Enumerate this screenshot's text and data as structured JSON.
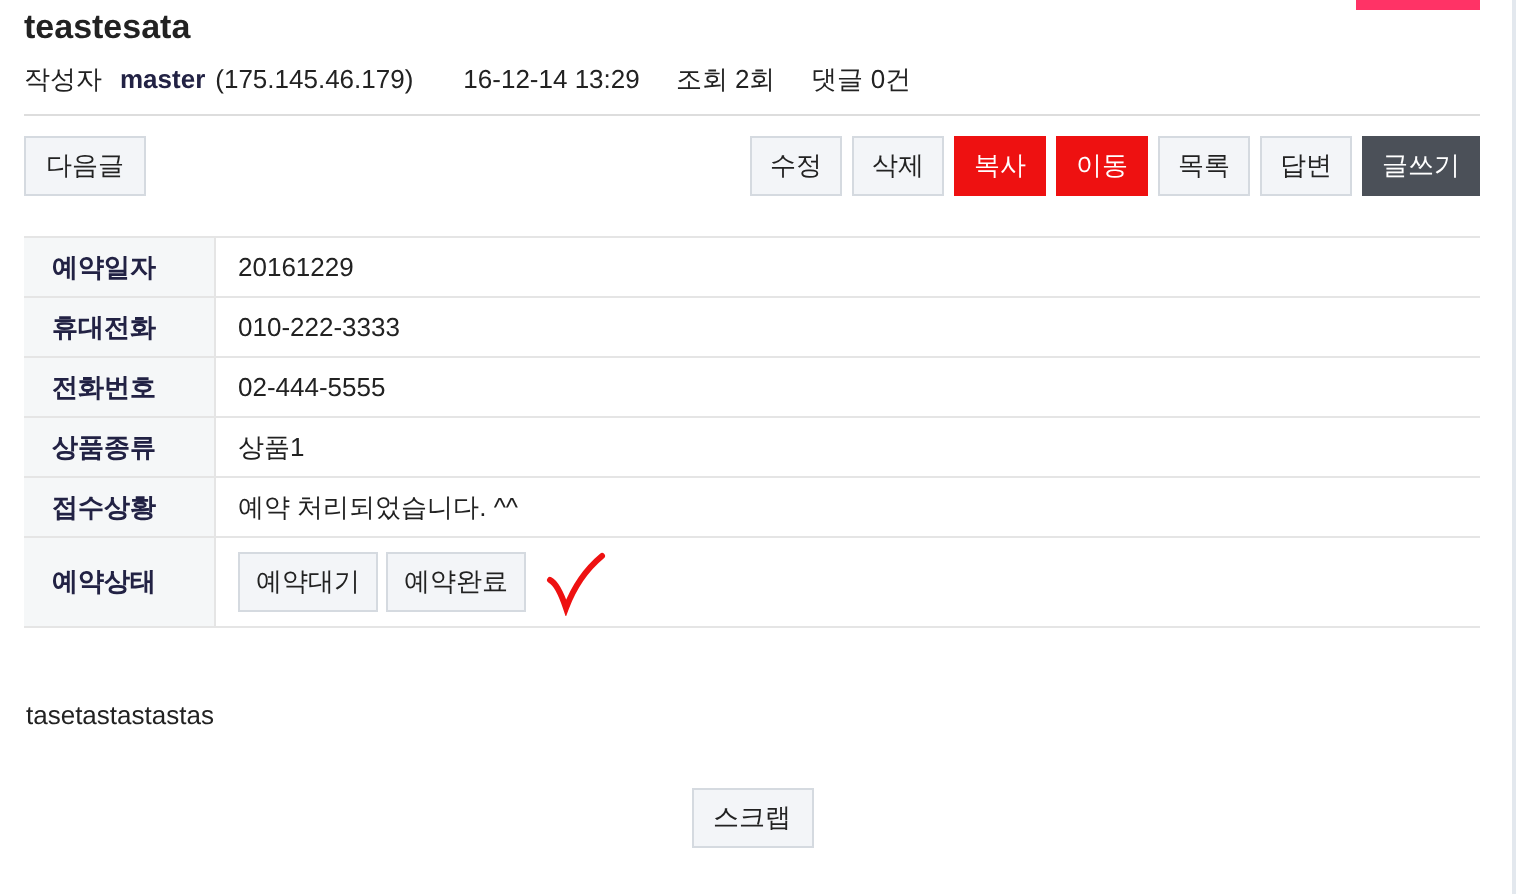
{
  "title": "teastesata",
  "meta": {
    "author_label": "작성자",
    "author": "master",
    "ip": "(175.145.46.179)",
    "date": "16-12-14 13:29",
    "views": "조회 2회",
    "comments": "댓글 0건"
  },
  "nav_button": "다음글",
  "actions": [
    {
      "label": "수정",
      "kind": "plain"
    },
    {
      "label": "삭제",
      "kind": "plain"
    },
    {
      "label": "복사",
      "kind": "red"
    },
    {
      "label": "이동",
      "kind": "red"
    },
    {
      "label": "목록",
      "kind": "plain"
    },
    {
      "label": "답변",
      "kind": "plain"
    },
    {
      "label": "글쓰기",
      "kind": "dark"
    }
  ],
  "fields": [
    {
      "label": "예약일자",
      "value": "20161229"
    },
    {
      "label": "휴대전화",
      "value": "010-222-3333"
    },
    {
      "label": "전화번호",
      "value": "02-444-5555"
    },
    {
      "label": "상품종류",
      "value": "상품1"
    },
    {
      "label": "접수상황",
      "value": "예약 처리되었습니다. ^^"
    }
  ],
  "status_row": {
    "label": "예약상태",
    "buttons": [
      "예약대기",
      "예약완료"
    ]
  },
  "body": "tasetastastastas",
  "scrap_button": "스크랩"
}
